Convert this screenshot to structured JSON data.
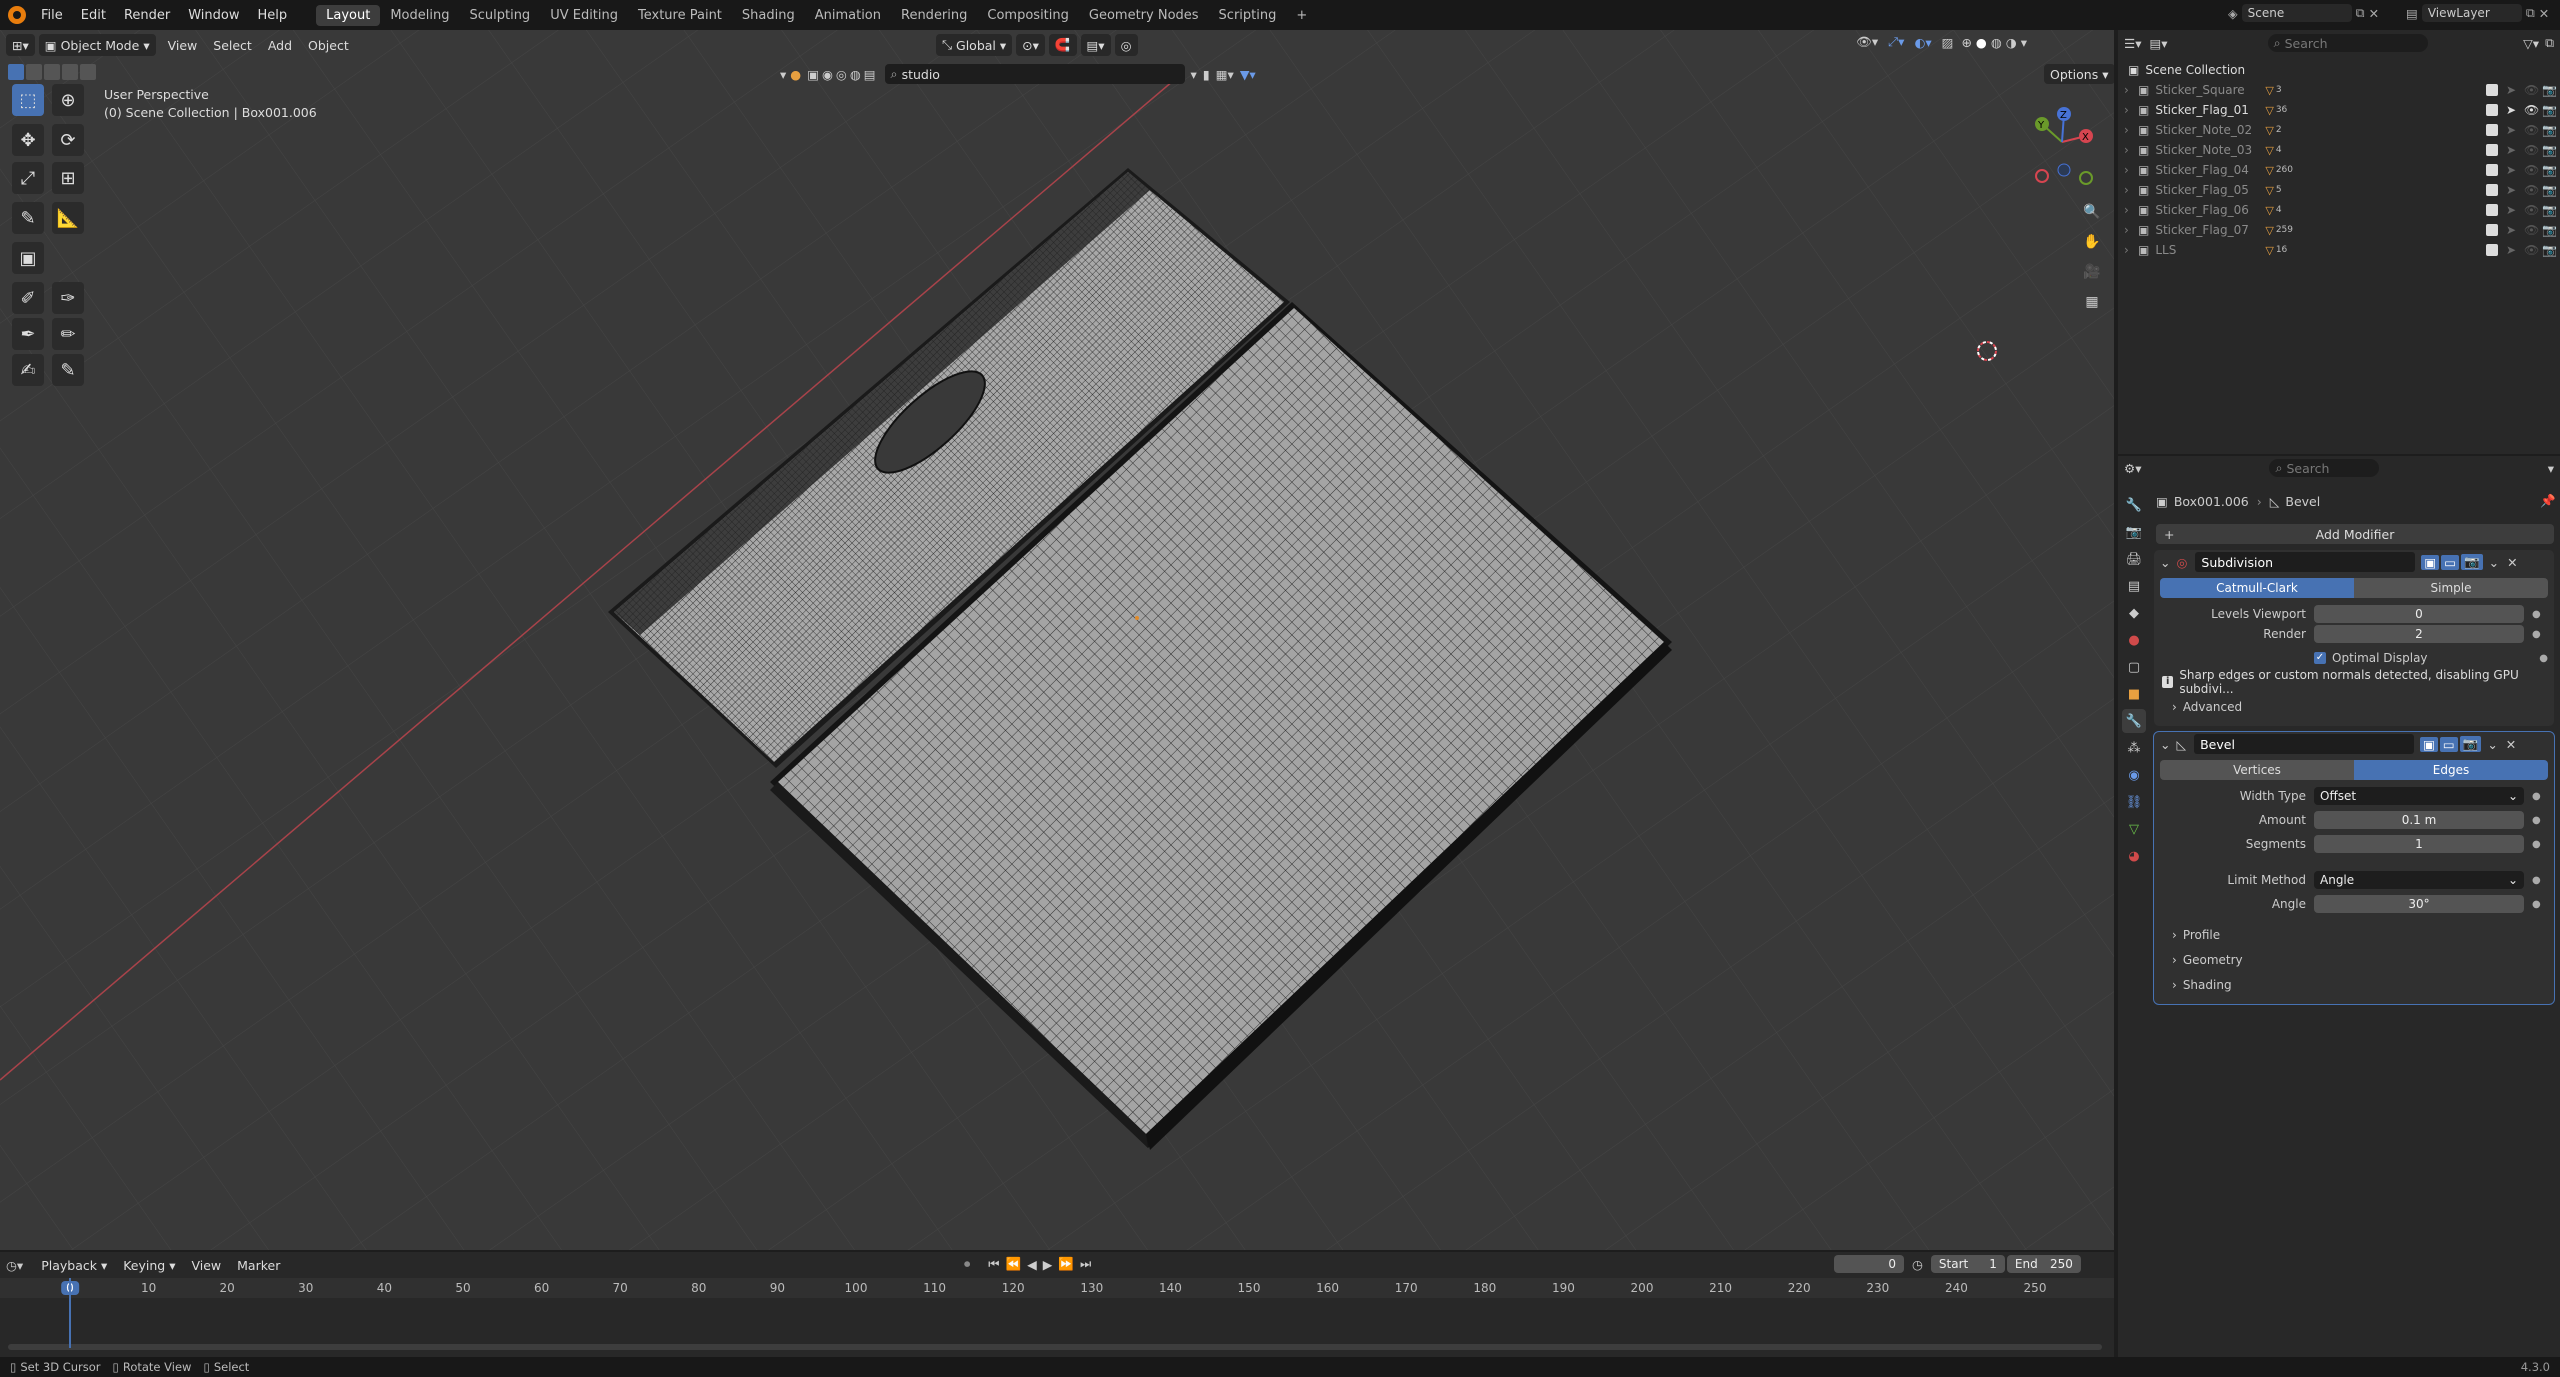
{
  "topbar": {
    "menus": [
      "File",
      "Edit",
      "Render",
      "Window",
      "Help"
    ],
    "workspaces": [
      "Layout",
      "Modeling",
      "Sculpting",
      "UV Editing",
      "Texture Paint",
      "Shading",
      "Animation",
      "Rendering",
      "Compositing",
      "Geometry Nodes",
      "Scripting"
    ],
    "active_workspace": "Layout",
    "scene": "Scene",
    "view_layer": "ViewLayer"
  },
  "viewport_header": {
    "mode": "Object Mode",
    "menus": [
      "View",
      "Select",
      "Add",
      "Object"
    ],
    "transform_orientation": "Global",
    "asset_search": "studio",
    "options": "Options"
  },
  "viewport": {
    "perspective": "User Perspective",
    "collection_info": "(0) Scene Collection | Box001.006",
    "gizmo_axes": {
      "x": "X",
      "y": "Y",
      "z": "Z"
    },
    "colors": {
      "x_axis": "#d64550",
      "y_axis": "#6a9a2a",
      "z_axis": "#4772d6",
      "background": "#393939",
      "mesh": "#a6a6a6",
      "wire": "#141414"
    }
  },
  "outliner": {
    "search_placeholder": "Search",
    "root": "Scene Collection",
    "items": [
      {
        "name": "Sticker_Square",
        "badge": "3"
      },
      {
        "name": "Sticker_Flag_01",
        "badge": "36"
      },
      {
        "name": "Sticker_Note_02",
        "badge": "2"
      },
      {
        "name": "Sticker_Note_03",
        "badge": "4"
      },
      {
        "name": "Sticker_Flag_04",
        "badge": "260"
      },
      {
        "name": "Sticker_Flag_05",
        "badge": "5"
      },
      {
        "name": "Sticker_Flag_06",
        "badge": "4"
      },
      {
        "name": "Sticker_Flag_07",
        "badge": "259"
      },
      {
        "name": "LLS",
        "badge": "16"
      }
    ]
  },
  "properties": {
    "search_placeholder": "Search",
    "object": "Box001.006",
    "modifier_crumb": "Bevel",
    "add_modifier": "Add Modifier",
    "subdivision": {
      "name": "Subdivision",
      "types": [
        "Catmull-Clark",
        "Simple"
      ],
      "active_type": "Catmull-Clark",
      "levels_viewport_label": "Levels Viewport",
      "levels_viewport": "0",
      "render_label": "Render",
      "render": "2",
      "optimal_display": "Optimal Display",
      "warning": "Sharp edges or custom normals detected, disabling GPU subdivi...",
      "advanced": "Advanced"
    },
    "bevel": {
      "name": "Bevel",
      "affect": [
        "Vertices",
        "Edges"
      ],
      "active_affect": "Edges",
      "width_type_label": "Width Type",
      "width_type": "Offset",
      "amount_label": "Amount",
      "amount": "0.1 m",
      "segments_label": "Segments",
      "segments": "1",
      "limit_method_label": "Limit Method",
      "limit_method": "Angle",
      "angle_label": "Angle",
      "angle": "30°",
      "subpanels": [
        "Profile",
        "Geometry",
        "Shading"
      ]
    }
  },
  "timeline": {
    "menus": [
      "Playback",
      "Keying",
      "View",
      "Marker"
    ],
    "current_frame": "0",
    "start_label": "Start",
    "start": "1",
    "end_label": "End",
    "end": "250",
    "ruler": [
      "0",
      "10",
      "20",
      "30",
      "40",
      "50",
      "60",
      "70",
      "80",
      "90",
      "100",
      "110",
      "120",
      "130",
      "140",
      "150",
      "160",
      "170",
      "180",
      "190",
      "200",
      "210",
      "220",
      "230",
      "240",
      "250"
    ]
  },
  "statusbar": {
    "hints": [
      "Set 3D Cursor",
      "Rotate View",
      "Select"
    ],
    "version": "4.3.0"
  }
}
